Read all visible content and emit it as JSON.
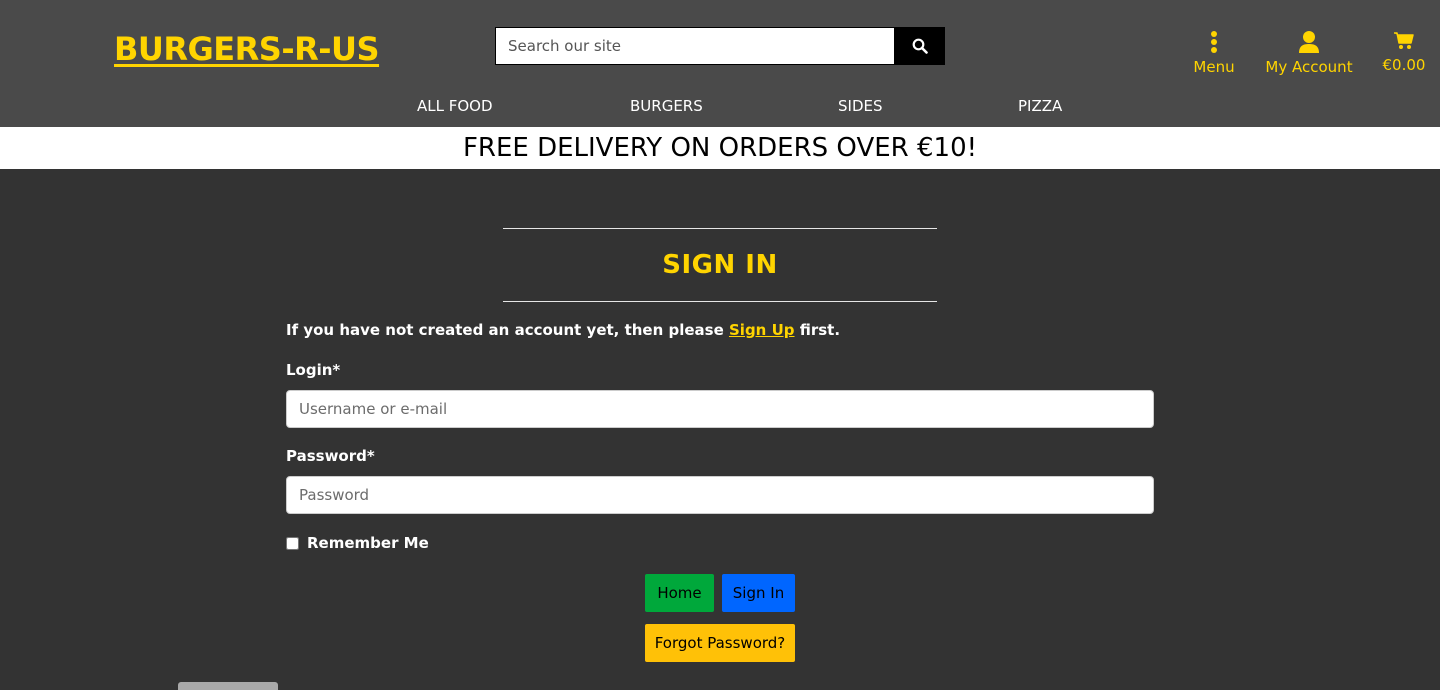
{
  "brand": {
    "name": "BURGERS-R-US",
    "color": "#ffd400"
  },
  "search": {
    "placeholder": "Search our site",
    "icon": "search-icon"
  },
  "utility": {
    "menu": {
      "label": "Menu",
      "icon": "vertical-ellipsis-icon"
    },
    "account": {
      "label": "My Account",
      "icon": "user-icon"
    },
    "cart": {
      "label": "€0.00",
      "icon": "shopping-cart-icon"
    }
  },
  "nav": {
    "items": [
      {
        "label": "ALL FOOD"
      },
      {
        "label": "BURGERS"
      },
      {
        "label": "SIDES"
      },
      {
        "label": "PIZZA"
      }
    ]
  },
  "promo": {
    "text": "FREE DELIVERY ON ORDERS OVER €10!"
  },
  "signin": {
    "title": "SIGN IN",
    "intro_before": "If you have not created an account yet, then please ",
    "intro_link": "Sign Up",
    "intro_after": " first.",
    "login_label": "Login*",
    "login_placeholder": "Username or e-mail",
    "password_label": "Password*",
    "password_placeholder": "Password",
    "remember_label": "Remember Me",
    "remember_checked": false,
    "home_button": "Home",
    "signin_button": "Sign In",
    "forgot_button": "Forgot Password?"
  },
  "colors": {
    "header_bg": "#4a4a4a",
    "page_bg": "#333333",
    "accent": "#ffd400",
    "home_button": "#00a83b",
    "signin_button": "#0066ff",
    "forgot_button": "#ffc107"
  }
}
